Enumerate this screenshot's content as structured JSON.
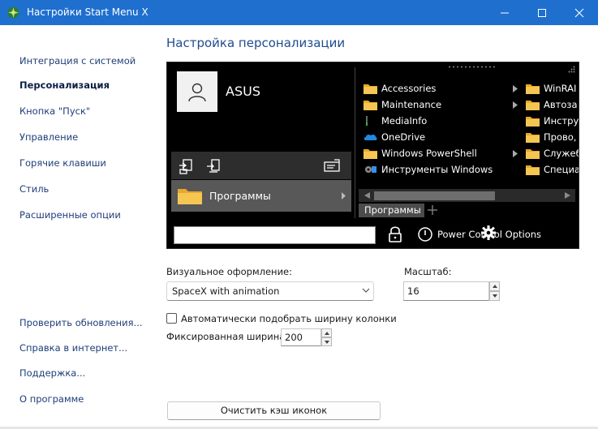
{
  "window": {
    "title": "Настройки Start Menu X"
  },
  "sidebar": {
    "top_items": [
      {
        "label": "Интеграция с системой"
      },
      {
        "label": "Персонализация"
      },
      {
        "label": "Кнопка \"Пуск\""
      },
      {
        "label": "Управление"
      },
      {
        "label": "Горячие клавиши"
      },
      {
        "label": "Стиль"
      },
      {
        "label": "Расширенные опции"
      }
    ],
    "active_index": 1,
    "bottom_items": [
      {
        "label": "Проверить обновления..."
      },
      {
        "label": "Справка в интернет..."
      },
      {
        "label": "Поддержка..."
      },
      {
        "label": "О программе"
      }
    ]
  },
  "main": {
    "section_title": "Настройка персонализации",
    "preview": {
      "username": "ASUS",
      "programs_label": "Программы",
      "menu_col1": [
        {
          "label": "Accessories",
          "icon": "folder-icon",
          "submenu": true
        },
        {
          "label": "Maintenance",
          "icon": "folder-icon",
          "submenu": true
        },
        {
          "label": "MediaInfo",
          "icon": "mediainfo-icon",
          "submenu": false
        },
        {
          "label": "OneDrive",
          "icon": "onedrive-icon",
          "submenu": false
        },
        {
          "label": "Windows PowerShell",
          "icon": "folder-icon",
          "submenu": true
        },
        {
          "label": "Инструменты Windows",
          "icon": "tools-icon",
          "submenu": false
        }
      ],
      "menu_col2": [
        {
          "label": "WinRAI",
          "icon": "folder-icon"
        },
        {
          "label": "Автоза",
          "icon": "folder-icon"
        },
        {
          "label": "Инстру",
          "icon": "folder-icon"
        },
        {
          "label": "Прово,",
          "icon": "folder-icon"
        },
        {
          "label": "Служеб",
          "icon": "folder-icon"
        },
        {
          "label": "Специа",
          "icon": "folder-icon"
        }
      ],
      "tab_label": "Программы",
      "power_label": "Power Control Options"
    },
    "visual_style": {
      "label": "Визуальное оформление:",
      "value": "SpaceX with animation"
    },
    "scale": {
      "label": "Масштаб:",
      "value": "16"
    },
    "auto_width": {
      "label": "Автоматически подобрать ширину колонки",
      "checked": false
    },
    "fixed_width": {
      "label": "Фиксированная ширина:",
      "value": "200"
    },
    "clear_cache_label": "Очистить кэш иконок"
  },
  "colors": {
    "titlebar": "#1f6fcf",
    "link": "#1f3e78",
    "section_title": "#1f4c8f",
    "folder": "#f2c14e"
  }
}
